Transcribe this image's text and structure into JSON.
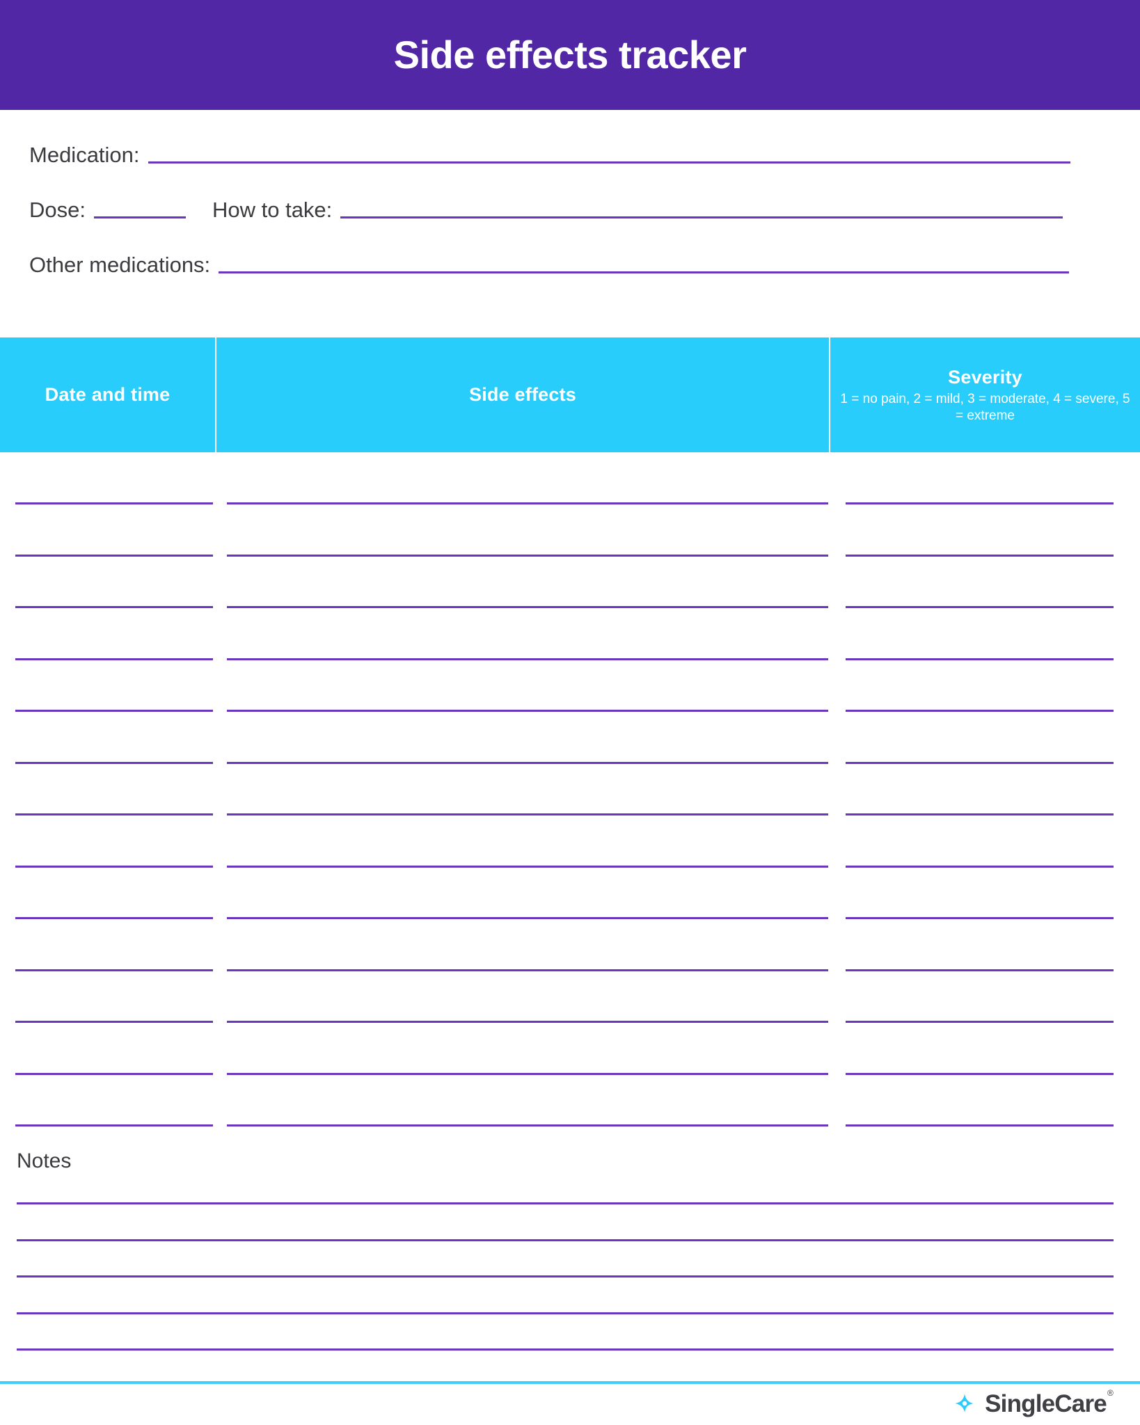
{
  "document": {
    "title": "Side effects tracker"
  },
  "colors": {
    "header_purple": "#5227A5",
    "table_header_cyan": "#29CDFB",
    "rule_purple": "#6B35BE",
    "label_gray": "#3b3b3f",
    "footer_divider_cyan": "#3ECFFB",
    "logo_cyan": "#29CDFB",
    "logo_text_gray": "#3f3f44"
  },
  "form": {
    "fields": [
      {
        "label": "Medication:",
        "value": ""
      },
      {
        "label": "Dose:",
        "value": ""
      },
      {
        "label": "How to take:",
        "value": ""
      },
      {
        "label": "Other medications:",
        "value": ""
      }
    ],
    "medication_label": "Medication:",
    "dose_label": "Dose:",
    "how_to_take_label": "How to take:",
    "other_medications_label": "Other medications:"
  },
  "table": {
    "columns": [
      {
        "title": "Date and time",
        "legend": ""
      },
      {
        "title": "Side effects",
        "legend": ""
      },
      {
        "title": "Severity",
        "legend": "1 = no pain, 2 = mild, 3 = moderate, 4 = severe, 5 = extreme"
      }
    ],
    "col_date_title": "Date and time",
    "col_side_effects_title": "Side effects",
    "col_severity_title": "Severity",
    "col_severity_legend": "1 = no pain, 2 = mild, 3 = moderate, 4 = severe, 5 = extreme",
    "row_count": 13,
    "rows": [
      {
        "date_and_time": "",
        "side_effects": "",
        "severity": ""
      },
      {
        "date_and_time": "",
        "side_effects": "",
        "severity": ""
      },
      {
        "date_and_time": "",
        "side_effects": "",
        "severity": ""
      },
      {
        "date_and_time": "",
        "side_effects": "",
        "severity": ""
      },
      {
        "date_and_time": "",
        "side_effects": "",
        "severity": ""
      },
      {
        "date_and_time": "",
        "side_effects": "",
        "severity": ""
      },
      {
        "date_and_time": "",
        "side_effects": "",
        "severity": ""
      },
      {
        "date_and_time": "",
        "side_effects": "",
        "severity": ""
      },
      {
        "date_and_time": "",
        "side_effects": "",
        "severity": ""
      },
      {
        "date_and_time": "",
        "side_effects": "",
        "severity": ""
      },
      {
        "date_and_time": "",
        "side_effects": "",
        "severity": ""
      },
      {
        "date_and_time": "",
        "side_effects": "",
        "severity": ""
      },
      {
        "date_and_time": "",
        "side_effects": "",
        "severity": ""
      }
    ]
  },
  "notes": {
    "title": "Notes",
    "line_count": 5,
    "lines": [
      "",
      "",
      "",
      "",
      ""
    ]
  },
  "footer": {
    "brand_name": "SingleCare",
    "registered_mark": "®",
    "logo_icon": "singlecare-pinwheel-icon"
  }
}
